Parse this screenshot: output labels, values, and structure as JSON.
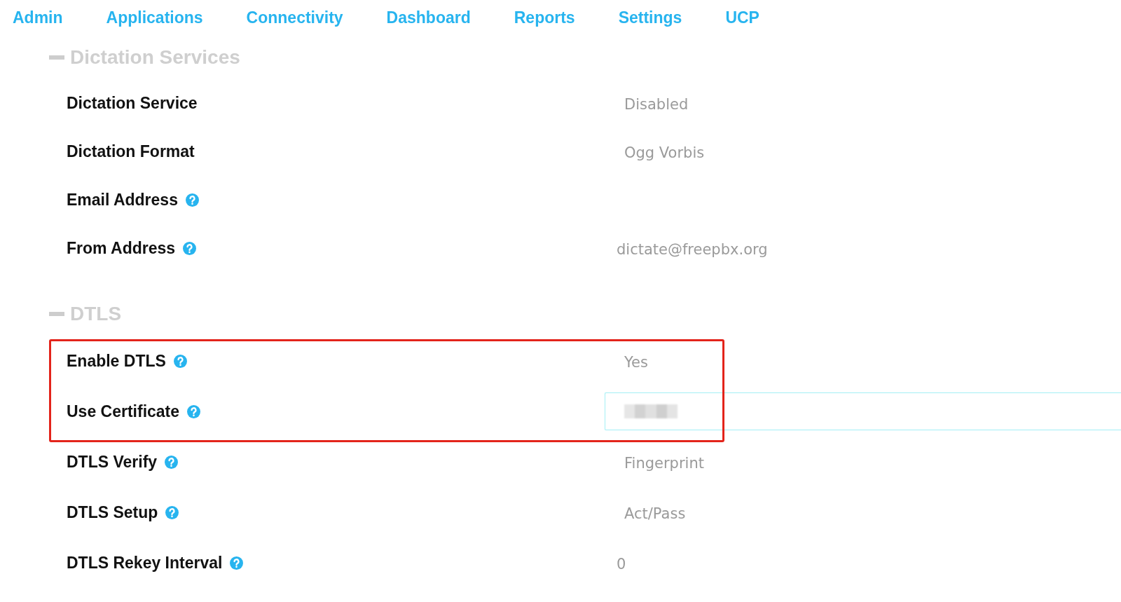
{
  "nav": [
    "Admin",
    "Applications",
    "Connectivity",
    "Dashboard",
    "Reports",
    "Settings",
    "UCP"
  ],
  "sections": [
    {
      "title": "Dictation Services",
      "expanded": true,
      "blocks": [
        {
          "highlighted": false,
          "rows": [
            {
              "label": "Dictation Service",
              "help": false,
              "kind": "text",
              "value": "Disabled"
            },
            {
              "label": "Dictation Format",
              "help": false,
              "kind": "text",
              "value": "Ogg Vorbis"
            },
            {
              "label": "Email Address",
              "help": true,
              "kind": "input"
            },
            {
              "label": "From Address",
              "help": true,
              "kind": "input",
              "value": "dictate@freepbx.org"
            }
          ]
        }
      ]
    },
    {
      "title": "DTLS",
      "expanded": true,
      "blocks": [
        {
          "highlighted": true,
          "rows": [
            {
              "label": "Enable DTLS",
              "help": true,
              "kind": "text",
              "value": "Yes"
            },
            {
              "label": "Use Certificate",
              "help": true,
              "kind": "select",
              "redacted": true
            }
          ]
        },
        {
          "highlighted": false,
          "rows": [
            {
              "label": "DTLS Verify",
              "help": true,
              "kind": "text",
              "value": "Fingerprint"
            },
            {
              "label": "DTLS Setup",
              "help": true,
              "kind": "text",
              "value": "Act/Pass"
            },
            {
              "label": "DTLS Rekey Interval",
              "help": true,
              "kind": "input",
              "value": "0"
            }
          ]
        }
      ]
    }
  ]
}
